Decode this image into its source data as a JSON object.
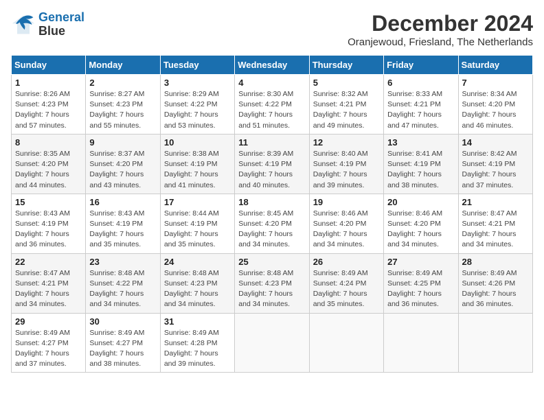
{
  "header": {
    "logo_line1": "General",
    "logo_line2": "Blue",
    "month_year": "December 2024",
    "location": "Oranjewoud, Friesland, The Netherlands"
  },
  "days_of_week": [
    "Sunday",
    "Monday",
    "Tuesday",
    "Wednesday",
    "Thursday",
    "Friday",
    "Saturday"
  ],
  "weeks": [
    [
      {
        "day": "1",
        "sunrise": "Sunrise: 8:26 AM",
        "sunset": "Sunset: 4:23 PM",
        "daylight": "Daylight: 7 hours and 57 minutes."
      },
      {
        "day": "2",
        "sunrise": "Sunrise: 8:27 AM",
        "sunset": "Sunset: 4:23 PM",
        "daylight": "Daylight: 7 hours and 55 minutes."
      },
      {
        "day": "3",
        "sunrise": "Sunrise: 8:29 AM",
        "sunset": "Sunset: 4:22 PM",
        "daylight": "Daylight: 7 hours and 53 minutes."
      },
      {
        "day": "4",
        "sunrise": "Sunrise: 8:30 AM",
        "sunset": "Sunset: 4:22 PM",
        "daylight": "Daylight: 7 hours and 51 minutes."
      },
      {
        "day": "5",
        "sunrise": "Sunrise: 8:32 AM",
        "sunset": "Sunset: 4:21 PM",
        "daylight": "Daylight: 7 hours and 49 minutes."
      },
      {
        "day": "6",
        "sunrise": "Sunrise: 8:33 AM",
        "sunset": "Sunset: 4:21 PM",
        "daylight": "Daylight: 7 hours and 47 minutes."
      },
      {
        "day": "7",
        "sunrise": "Sunrise: 8:34 AM",
        "sunset": "Sunset: 4:20 PM",
        "daylight": "Daylight: 7 hours and 46 minutes."
      }
    ],
    [
      {
        "day": "8",
        "sunrise": "Sunrise: 8:35 AM",
        "sunset": "Sunset: 4:20 PM",
        "daylight": "Daylight: 7 hours and 44 minutes."
      },
      {
        "day": "9",
        "sunrise": "Sunrise: 8:37 AM",
        "sunset": "Sunset: 4:20 PM",
        "daylight": "Daylight: 7 hours and 43 minutes."
      },
      {
        "day": "10",
        "sunrise": "Sunrise: 8:38 AM",
        "sunset": "Sunset: 4:19 PM",
        "daylight": "Daylight: 7 hours and 41 minutes."
      },
      {
        "day": "11",
        "sunrise": "Sunrise: 8:39 AM",
        "sunset": "Sunset: 4:19 PM",
        "daylight": "Daylight: 7 hours and 40 minutes."
      },
      {
        "day": "12",
        "sunrise": "Sunrise: 8:40 AM",
        "sunset": "Sunset: 4:19 PM",
        "daylight": "Daylight: 7 hours and 39 minutes."
      },
      {
        "day": "13",
        "sunrise": "Sunrise: 8:41 AM",
        "sunset": "Sunset: 4:19 PM",
        "daylight": "Daylight: 7 hours and 38 minutes."
      },
      {
        "day": "14",
        "sunrise": "Sunrise: 8:42 AM",
        "sunset": "Sunset: 4:19 PM",
        "daylight": "Daylight: 7 hours and 37 minutes."
      }
    ],
    [
      {
        "day": "15",
        "sunrise": "Sunrise: 8:43 AM",
        "sunset": "Sunset: 4:19 PM",
        "daylight": "Daylight: 7 hours and 36 minutes."
      },
      {
        "day": "16",
        "sunrise": "Sunrise: 8:43 AM",
        "sunset": "Sunset: 4:19 PM",
        "daylight": "Daylight: 7 hours and 35 minutes."
      },
      {
        "day": "17",
        "sunrise": "Sunrise: 8:44 AM",
        "sunset": "Sunset: 4:19 PM",
        "daylight": "Daylight: 7 hours and 35 minutes."
      },
      {
        "day": "18",
        "sunrise": "Sunrise: 8:45 AM",
        "sunset": "Sunset: 4:20 PM",
        "daylight": "Daylight: 7 hours and 34 minutes."
      },
      {
        "day": "19",
        "sunrise": "Sunrise: 8:46 AM",
        "sunset": "Sunset: 4:20 PM",
        "daylight": "Daylight: 7 hours and 34 minutes."
      },
      {
        "day": "20",
        "sunrise": "Sunrise: 8:46 AM",
        "sunset": "Sunset: 4:20 PM",
        "daylight": "Daylight: 7 hours and 34 minutes."
      },
      {
        "day": "21",
        "sunrise": "Sunrise: 8:47 AM",
        "sunset": "Sunset: 4:21 PM",
        "daylight": "Daylight: 7 hours and 34 minutes."
      }
    ],
    [
      {
        "day": "22",
        "sunrise": "Sunrise: 8:47 AM",
        "sunset": "Sunset: 4:21 PM",
        "daylight": "Daylight: 7 hours and 34 minutes."
      },
      {
        "day": "23",
        "sunrise": "Sunrise: 8:48 AM",
        "sunset": "Sunset: 4:22 PM",
        "daylight": "Daylight: 7 hours and 34 minutes."
      },
      {
        "day": "24",
        "sunrise": "Sunrise: 8:48 AM",
        "sunset": "Sunset: 4:23 PM",
        "daylight": "Daylight: 7 hours and 34 minutes."
      },
      {
        "day": "25",
        "sunrise": "Sunrise: 8:48 AM",
        "sunset": "Sunset: 4:23 PM",
        "daylight": "Daylight: 7 hours and 34 minutes."
      },
      {
        "day": "26",
        "sunrise": "Sunrise: 8:49 AM",
        "sunset": "Sunset: 4:24 PM",
        "daylight": "Daylight: 7 hours and 35 minutes."
      },
      {
        "day": "27",
        "sunrise": "Sunrise: 8:49 AM",
        "sunset": "Sunset: 4:25 PM",
        "daylight": "Daylight: 7 hours and 36 minutes."
      },
      {
        "day": "28",
        "sunrise": "Sunrise: 8:49 AM",
        "sunset": "Sunset: 4:26 PM",
        "daylight": "Daylight: 7 hours and 36 minutes."
      }
    ],
    [
      {
        "day": "29",
        "sunrise": "Sunrise: 8:49 AM",
        "sunset": "Sunset: 4:27 PM",
        "daylight": "Daylight: 7 hours and 37 minutes."
      },
      {
        "day": "30",
        "sunrise": "Sunrise: 8:49 AM",
        "sunset": "Sunset: 4:27 PM",
        "daylight": "Daylight: 7 hours and 38 minutes."
      },
      {
        "day": "31",
        "sunrise": "Sunrise: 8:49 AM",
        "sunset": "Sunset: 4:28 PM",
        "daylight": "Daylight: 7 hours and 39 minutes."
      },
      {
        "day": "",
        "sunrise": "",
        "sunset": "",
        "daylight": ""
      },
      {
        "day": "",
        "sunrise": "",
        "sunset": "",
        "daylight": ""
      },
      {
        "day": "",
        "sunrise": "",
        "sunset": "",
        "daylight": ""
      },
      {
        "day": "",
        "sunrise": "",
        "sunset": "",
        "daylight": ""
      }
    ]
  ]
}
